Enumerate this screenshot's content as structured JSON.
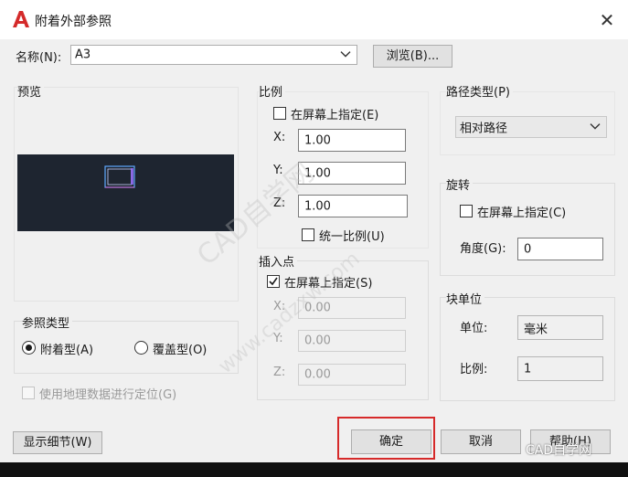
{
  "window": {
    "title": "附着外部参照",
    "close_glyph": "✕"
  },
  "name_row": {
    "label": "名称(N):",
    "value": "A3",
    "browse_label": "浏览(B)..."
  },
  "preview": {
    "label": "预览"
  },
  "reference_type": {
    "label": "参照类型",
    "options": [
      "附着型(A)",
      "覆盖型(O)"
    ],
    "selected": "附着型(A)"
  },
  "geo": {
    "label": "使用地理数据进行定位(G)"
  },
  "scale": {
    "label": "比例",
    "specify_on_screen": "在屏幕上指定(E)",
    "x_label": "X:",
    "x_value": "1.00",
    "y_label": "Y:",
    "y_value": "1.00",
    "z_label": "Z:",
    "z_value": "1.00",
    "uniform": "统一比例(U)"
  },
  "insertion": {
    "label": "插入点",
    "specify_on_screen": "在屏幕上指定(S)",
    "x_label": "X:",
    "x_value": "0.00",
    "y_label": "Y:",
    "y_value": "0.00",
    "z_label": "Z:",
    "z_value": "0.00"
  },
  "path_type": {
    "label": "路径类型(P)",
    "value": "相对路径"
  },
  "rotation": {
    "label": "旋转",
    "specify_on_screen": "在屏幕上指定(C)",
    "angle_label": "角度(G):",
    "angle_value": "0"
  },
  "block_unit": {
    "label": "块单位",
    "unit_label": "单位:",
    "unit_value": "毫米",
    "factor_label": "比例:",
    "factor_value": "1"
  },
  "buttons": {
    "details": "显示细节(W)",
    "ok": "确定",
    "cancel": "取消",
    "help": "帮助(H)"
  },
  "watermark": {
    "text": "CAD自学网",
    "url_text": "www.cadzxw.com"
  },
  "colors": {
    "accent_red": "#d62a2a",
    "preview_bg": "#1e2530",
    "dialog_bg": "#f0f0f0"
  }
}
